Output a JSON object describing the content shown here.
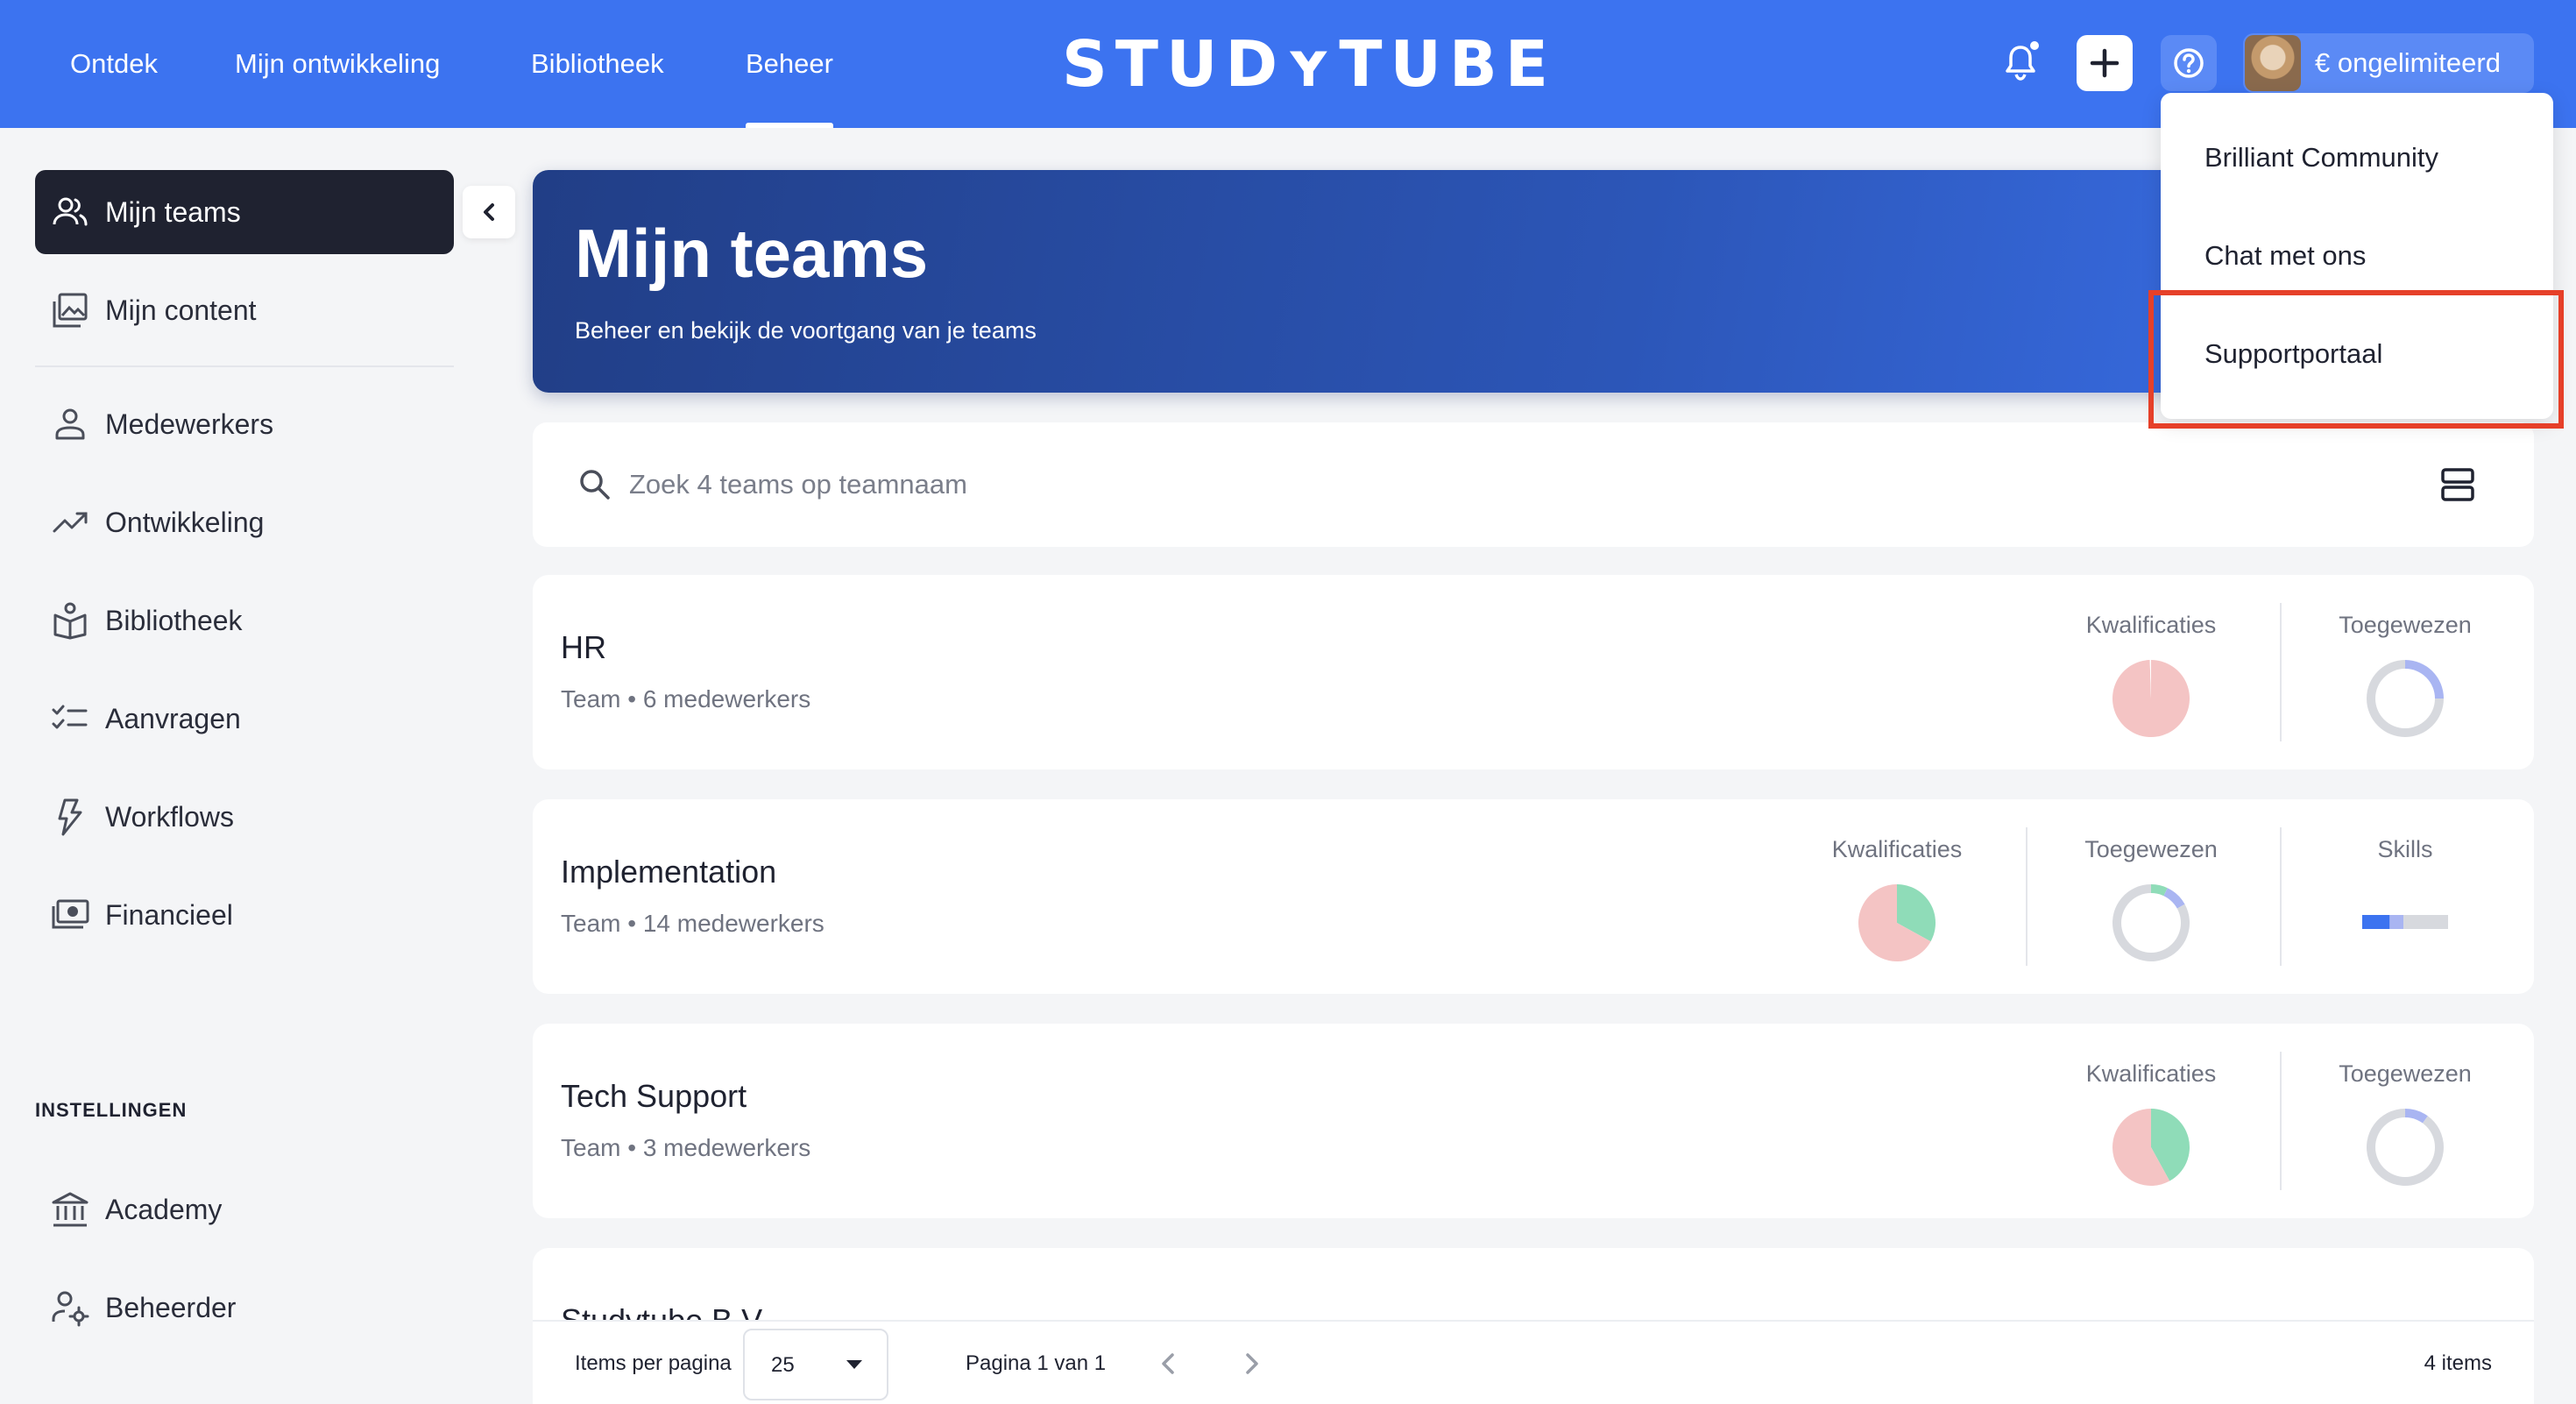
{
  "topnav": {
    "items": [
      "Ontdek",
      "Mijn ontwikkeling",
      "Bibliotheek",
      "Beheer"
    ],
    "active": "Beheer",
    "logo": "STUDʏTUBE",
    "account_label": "€ ongelimiteerd",
    "brand_color": "#3c73f0"
  },
  "help_menu": {
    "items": [
      "Brilliant Community",
      "Chat met ons",
      "Supportportaal"
    ],
    "highlighted": "Supportportaal"
  },
  "sidebar": {
    "items": [
      {
        "label": "Mijn teams",
        "icon": "users-icon",
        "active": true
      },
      {
        "label": "Mijn content",
        "icon": "images-icon"
      },
      {
        "label": "Medewerkers",
        "icon": "user-icon"
      },
      {
        "label": "Ontwikkeling",
        "icon": "trend-up-icon"
      },
      {
        "label": "Bibliotheek",
        "icon": "library-icon"
      },
      {
        "label": "Aanvragen",
        "icon": "checklist-icon"
      },
      {
        "label": "Workflows",
        "icon": "lightning-icon"
      },
      {
        "label": "Financieel",
        "icon": "money-icon"
      }
    ],
    "settings_heading": "INSTELLINGEN",
    "settings_items": [
      {
        "label": "Academy",
        "icon": "institution-icon"
      },
      {
        "label": "Beheerder",
        "icon": "user-gear-icon"
      }
    ]
  },
  "hero": {
    "title": "Mijn teams",
    "subtitle": "Beheer en bekijk de voortgang van je teams"
  },
  "search": {
    "placeholder": "Zoek 4 teams op teamnaam",
    "value": ""
  },
  "teams": [
    {
      "name": "HR",
      "meta": "Team • 6 medewerkers",
      "metrics": [
        {
          "label": "Kwalificaties",
          "type": "pie",
          "slices": [
            {
              "value": 0.995,
              "color": "#f4c4c4"
            },
            {
              "value": 0.005,
              "color": "#ffffff"
            }
          ]
        },
        {
          "label": "Toegewezen",
          "type": "donut",
          "slices": [
            {
              "value": 0.25,
              "color": "#a9b5f2"
            },
            {
              "value": 0.75,
              "color": "#d7d9de"
            }
          ]
        }
      ]
    },
    {
      "name": "Implementation",
      "meta": "Team • 14 medewerkers",
      "metrics": [
        {
          "label": "Kwalificaties",
          "type": "pie",
          "slices": [
            {
              "value": 0.33,
              "color": "#8fdcb8"
            },
            {
              "value": 0.67,
              "color": "#f4c4c4"
            }
          ]
        },
        {
          "label": "Toegewezen",
          "type": "donut",
          "slices": [
            {
              "value": 0.07,
              "color": "#8fdcb8"
            },
            {
              "value": 0.1,
              "color": "#a9b5f2"
            },
            {
              "value": 0.83,
              "color": "#d7d9de"
            }
          ]
        },
        {
          "label": "Skills",
          "type": "bar",
          "segments": [
            {
              "value": 0.32,
              "color": "#3c73f0"
            },
            {
              "value": 0.16,
              "color": "#a9b5f2"
            },
            {
              "value": 0.52,
              "color": "#d7d9de"
            }
          ]
        }
      ]
    },
    {
      "name": "Tech Support",
      "meta": "Team • 3 medewerkers",
      "metrics": [
        {
          "label": "Kwalificaties",
          "type": "pie",
          "slices": [
            {
              "value": 0.42,
              "color": "#8fdcb8"
            },
            {
              "value": 0.58,
              "color": "#f4c4c4"
            }
          ]
        },
        {
          "label": "Toegewezen",
          "type": "donut",
          "slices": [
            {
              "value": 0.1,
              "color": "#a9b5f2"
            },
            {
              "value": 0.9,
              "color": "#d7d9de"
            }
          ]
        }
      ]
    },
    {
      "name": "Studytube B.V.",
      "meta": "",
      "metrics": []
    }
  ],
  "pagination": {
    "items_per_page_label": "Items per pagina",
    "items_per_page_value": "25",
    "page_info": "Pagina 1 van 1",
    "total": "4 items"
  }
}
